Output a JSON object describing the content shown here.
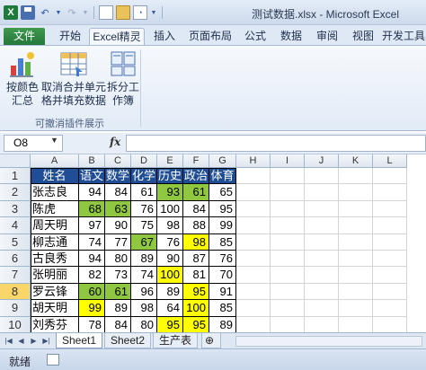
{
  "window": {
    "title": "测试数据.xlsx - Microsoft Excel"
  },
  "ribbon": {
    "tabs": [
      "文件",
      "开始",
      "Excel精灵",
      "插入",
      "页面布局",
      "公式",
      "数据",
      "审阅",
      "视图",
      "开发工具"
    ],
    "active_tab": "Excel精灵",
    "buttons": [
      {
        "line1": "按颜色",
        "line2": "汇总"
      },
      {
        "line1": "取消合并单元",
        "line2": "格并填充数据"
      },
      {
        "line1": "拆分工",
        "line2": "作簿"
      }
    ],
    "group_label": "可撤消插件展示"
  },
  "formula_bar": {
    "name_box": "O8",
    "fx_label": "fx",
    "formula": ""
  },
  "grid": {
    "columns": [
      "A",
      "B",
      "C",
      "D",
      "E",
      "F",
      "G",
      "H",
      "I",
      "J",
      "K",
      "L"
    ],
    "rows": [
      "1",
      "2",
      "3",
      "4",
      "5",
      "6",
      "7",
      "8",
      "9",
      "10",
      "11"
    ],
    "selected_row": "8",
    "table": {
      "headers": [
        "姓名",
        "语文",
        "数学",
        "化学",
        "历史",
        "政治",
        "体育"
      ],
      "rows": [
        {
          "name": "张志良",
          "scores": [
            "94",
            "84",
            "61",
            "93",
            "61",
            "65"
          ]
        },
        {
          "name": "陈虎",
          "scores": [
            "68",
            "63",
            "76",
            "100",
            "84",
            "95"
          ]
        },
        {
          "name": "周天明",
          "scores": [
            "97",
            "90",
            "75",
            "98",
            "88",
            "99"
          ]
        },
        {
          "name": "柳志通",
          "scores": [
            "74",
            "77",
            "67",
            "76",
            "98",
            "85"
          ]
        },
        {
          "name": "古良秀",
          "scores": [
            "94",
            "80",
            "89",
            "90",
            "87",
            "76"
          ]
        },
        {
          "name": "张明丽",
          "scores": [
            "82",
            "73",
            "74",
            "100",
            "81",
            "70"
          ]
        },
        {
          "name": "罗云锋",
          "scores": [
            "60",
            "61",
            "96",
            "89",
            "95",
            "91"
          ]
        },
        {
          "name": "胡天明",
          "scores": [
            "99",
            "89",
            "98",
            "64",
            "100",
            "85"
          ]
        },
        {
          "name": "刘秀芬",
          "scores": [
            "78",
            "84",
            "80",
            "95",
            "95",
            "89"
          ]
        }
      ]
    },
    "highlight_colors": {
      "green": "#8fc740",
      "yellow": "#ffff00",
      "header": "#1f4e96"
    }
  },
  "sheets": {
    "tabs": [
      "Sheet1",
      "Sheet2",
      "生产表"
    ],
    "active": "Sheet1"
  },
  "status": {
    "text": "就绪"
  }
}
